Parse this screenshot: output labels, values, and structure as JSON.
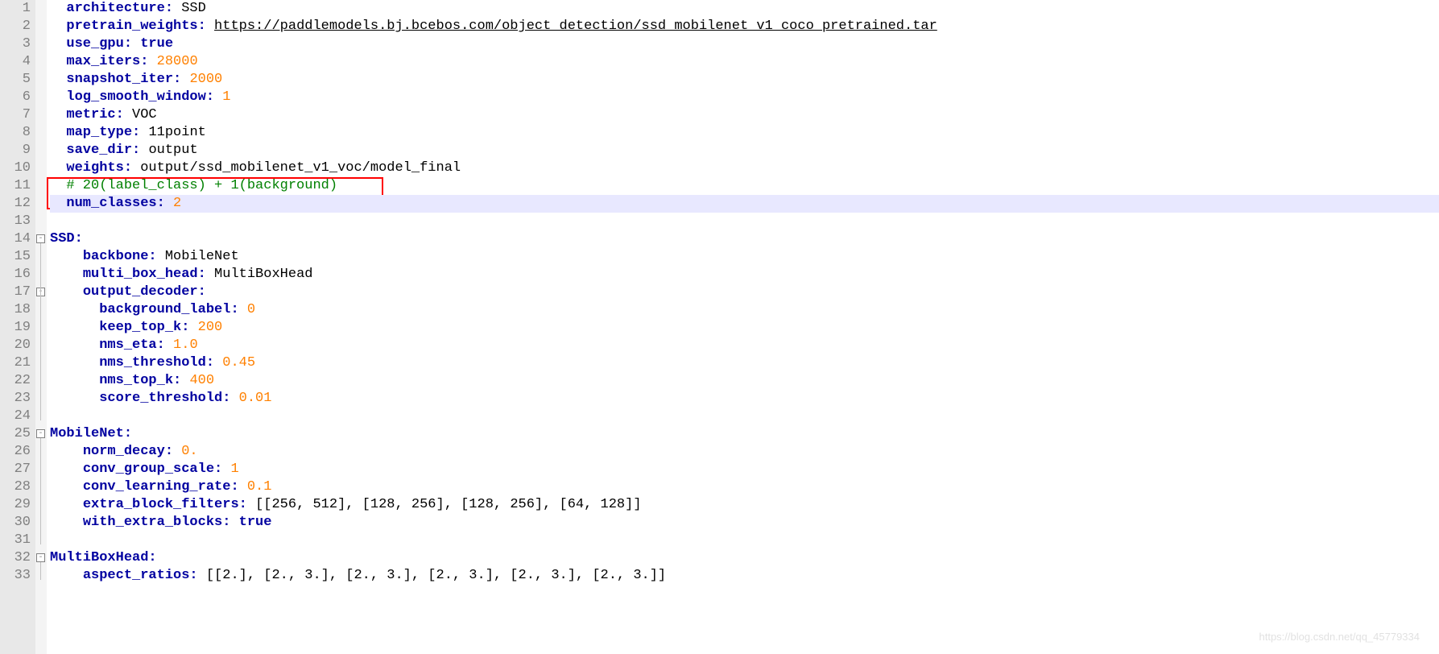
{
  "gutter": {
    "start": 1,
    "end": 33
  },
  "fold_marks": [
    {
      "line": 14,
      "glyph": "⊟"
    },
    {
      "line": 17,
      "glyph": "⊟"
    },
    {
      "line": 25,
      "glyph": "⊟"
    },
    {
      "line": 32,
      "glyph": "⊟"
    }
  ],
  "current_line": 12,
  "lines": {
    "1": {
      "indent": 1,
      "key": "architecture:",
      "val": "SSD",
      "valClass": "val"
    },
    "2": {
      "indent": 1,
      "key": "pretrain_weights:",
      "val": "https://paddlemodels.bj.bcebos.com/object_detection/ssd_mobilenet_v1_coco_pretrained.tar",
      "valClass": "url"
    },
    "3": {
      "indent": 1,
      "key": "use_gpu:",
      "val": "true",
      "valClass": "bool"
    },
    "4": {
      "indent": 1,
      "key": "max_iters:",
      "val": "28000",
      "valClass": "num"
    },
    "5": {
      "indent": 1,
      "key": "snapshot_iter:",
      "val": "2000",
      "valClass": "num"
    },
    "6": {
      "indent": 1,
      "key": "log_smooth_window:",
      "val": "1",
      "valClass": "num"
    },
    "7": {
      "indent": 1,
      "key": "metric:",
      "val": "VOC",
      "valClass": "val"
    },
    "8": {
      "indent": 1,
      "key": "map_type:",
      "val": "11point",
      "valClass": "val"
    },
    "9": {
      "indent": 1,
      "key": "save_dir:",
      "val": "output",
      "valClass": "val"
    },
    "10": {
      "indent": 1,
      "key": "weights:",
      "val": "output/ssd_mobilenet_v1_voc/model_final",
      "valClass": "val"
    },
    "11": {
      "indent": 1,
      "comment": "# 20(label_class) + 1(background)"
    },
    "12": {
      "indent": 1,
      "key": "num_classes:",
      "val": "2",
      "valClass": "num"
    },
    "13": {
      "blank": true
    },
    "14": {
      "indent": 0,
      "key": "SSD:",
      "val": "",
      "valClass": "val"
    },
    "15": {
      "indent": 2,
      "key": "backbone:",
      "val": "MobileNet",
      "valClass": "val"
    },
    "16": {
      "indent": 2,
      "key": "multi_box_head:",
      "val": "MultiBoxHead",
      "valClass": "val"
    },
    "17": {
      "indent": 2,
      "key": "output_decoder:",
      "val": "",
      "valClass": "val"
    },
    "18": {
      "indent": 3,
      "key": "background_label:",
      "val": "0",
      "valClass": "num"
    },
    "19": {
      "indent": 3,
      "key": "keep_top_k:",
      "val": "200",
      "valClass": "num"
    },
    "20": {
      "indent": 3,
      "key": "nms_eta:",
      "val": "1.0",
      "valClass": "num"
    },
    "21": {
      "indent": 3,
      "key": "nms_threshold:",
      "val": "0.45",
      "valClass": "num"
    },
    "22": {
      "indent": 3,
      "key": "nms_top_k:",
      "val": "400",
      "valClass": "num"
    },
    "23": {
      "indent": 3,
      "key": "score_threshold:",
      "val": "0.01",
      "valClass": "num"
    },
    "24": {
      "blank": true
    },
    "25": {
      "indent": 0,
      "key": "MobileNet:",
      "val": "",
      "valClass": "val"
    },
    "26": {
      "indent": 2,
      "key": "norm_decay:",
      "val": "0.",
      "valClass": "num"
    },
    "27": {
      "indent": 2,
      "key": "conv_group_scale:",
      "val": "1",
      "valClass": "num"
    },
    "28": {
      "indent": 2,
      "key": "conv_learning_rate:",
      "val": "0.1",
      "valClass": "num"
    },
    "29": {
      "indent": 2,
      "key": "extra_block_filters:",
      "val": "[[256, 512], [128, 256], [128, 256], [64, 128]]",
      "valClass": "punct"
    },
    "30": {
      "indent": 2,
      "key": "with_extra_blocks:",
      "val": "true",
      "valClass": "bool"
    },
    "31": {
      "blank": true
    },
    "32": {
      "indent": 0,
      "key": "MultiBoxHead:",
      "val": "",
      "valClass": "val"
    },
    "33": {
      "indent": 2,
      "key": "aspect_ratios:",
      "val": "[[2.], [2., 3.], [2., 3.], [2., 3.], [2., 3.], [2., 3.]]",
      "valClass": "punct",
      "cutoff": true
    }
  },
  "watermark": "https://blog.csdn.net/qq_45779334"
}
